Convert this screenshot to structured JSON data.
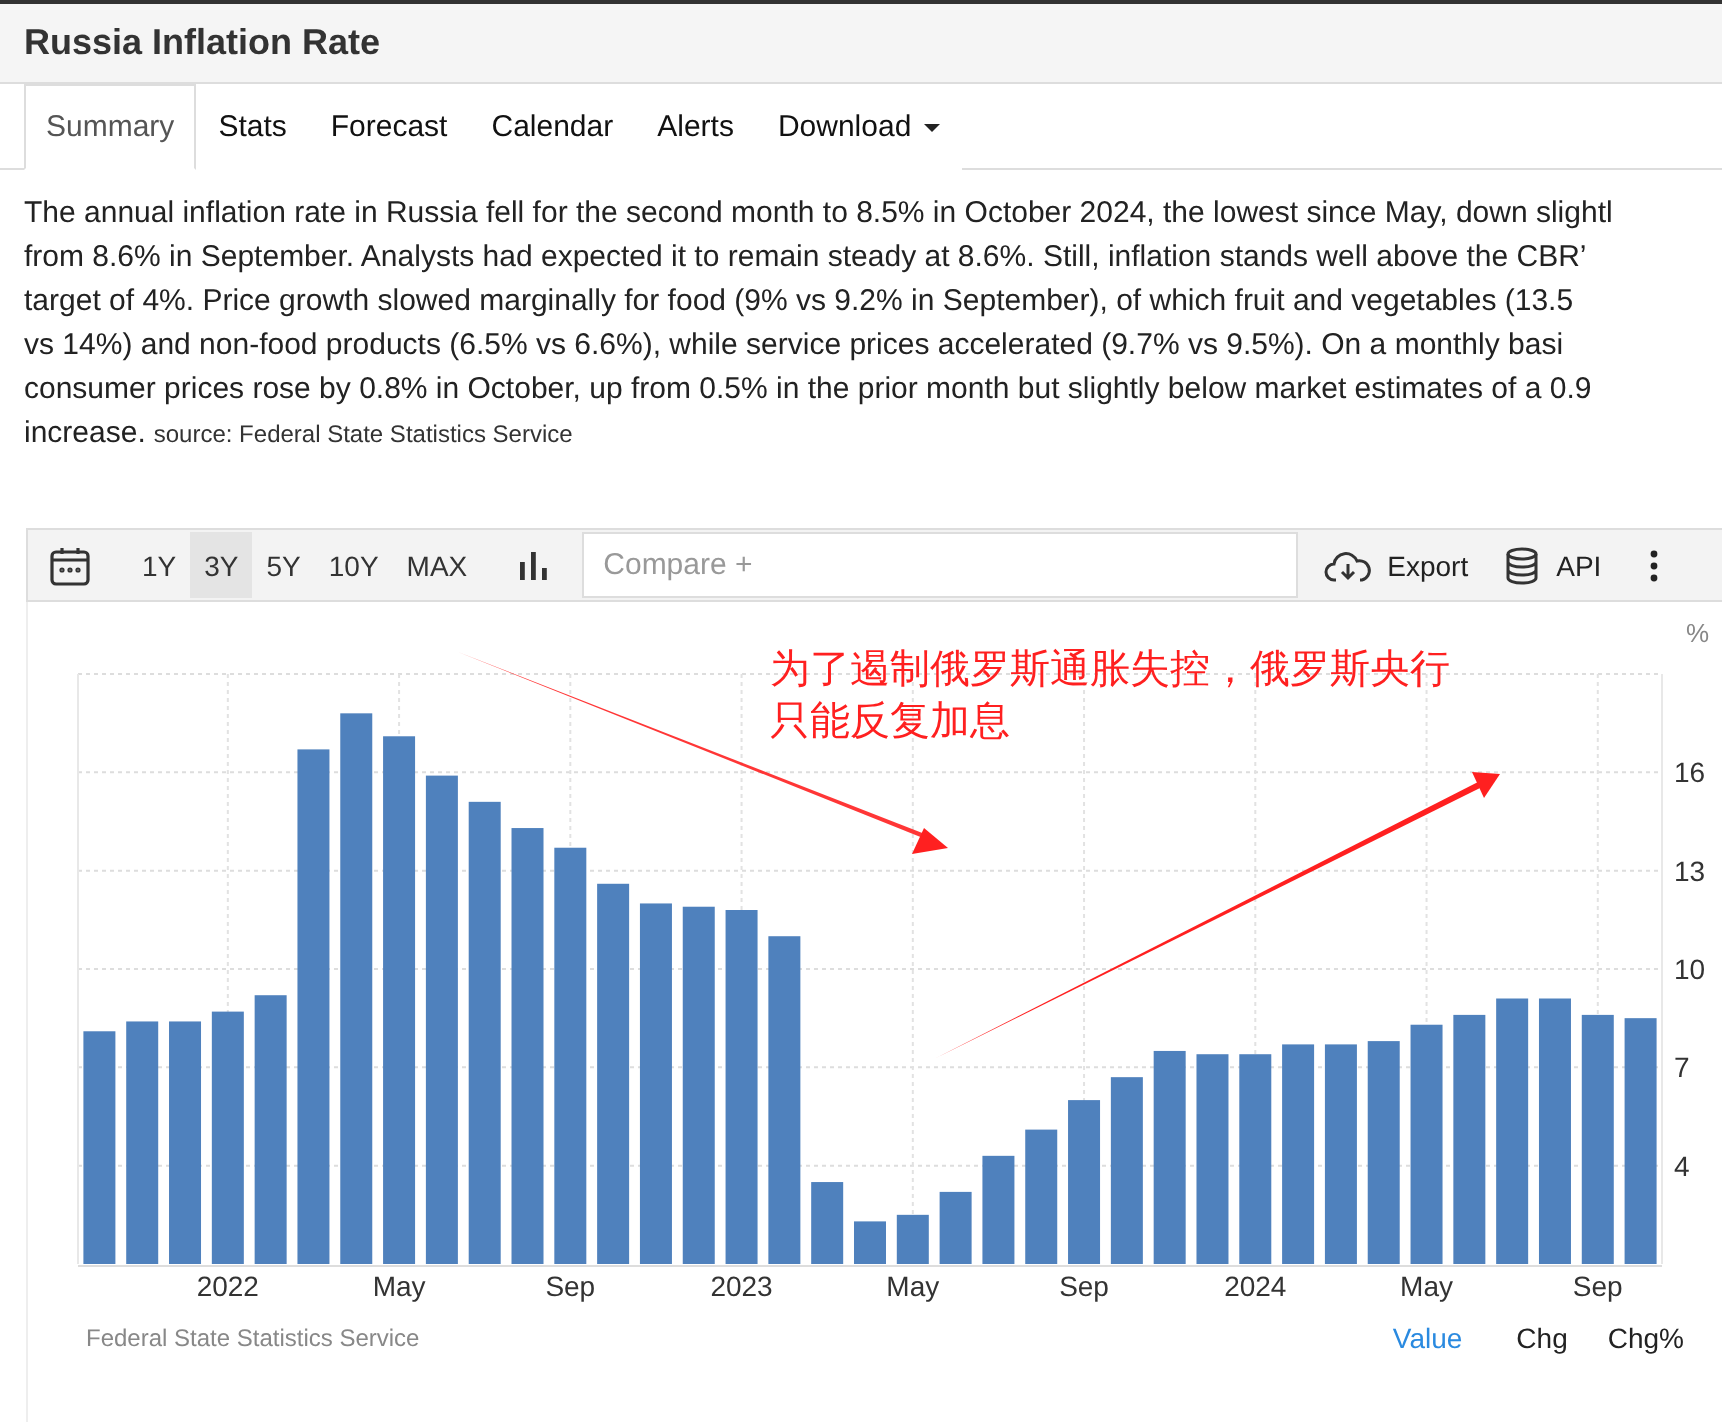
{
  "page_title": "Russia Inflation Rate",
  "tabs": [
    {
      "label": "Summary",
      "selected": true,
      "kind": "tab"
    },
    {
      "label": "Stats",
      "selected": false,
      "kind": "tab"
    },
    {
      "label": "Forecast",
      "selected": false,
      "kind": "tab"
    },
    {
      "label": "Calendar",
      "selected": false,
      "kind": "tab"
    },
    {
      "label": "Alerts",
      "selected": false,
      "kind": "tab"
    },
    {
      "label": "Download",
      "selected": false,
      "kind": "dropdown"
    }
  ],
  "summary": {
    "lines": [
      "The annual inflation rate in Russia fell for the second month to 8.5% in October 2024, the lowest since May, down slightl",
      "from 8.6% in September. Analysts had expected it to remain steady at 8.6%. Still, inflation stands well above the CBR’",
      "target of 4%. Price growth slowed marginally for food (9% vs 9.2% in September), of which fruit and vegetables (13.5",
      "vs 14%) and non-food products (6.5% vs 6.6%), while service prices accelerated (9.7% vs 9.5%). On a monthly basi",
      "consumer prices rose by 0.8% in October, up from 0.5% in the prior month but slightly below market estimates of a 0.9",
      "increase."
    ],
    "source": "source: Federal State Statistics Service"
  },
  "toolbar": {
    "ranges": [
      {
        "label": "1Y",
        "selected": false
      },
      {
        "label": "3Y",
        "selected": true
      },
      {
        "label": "5Y",
        "selected": false
      },
      {
        "label": "10Y",
        "selected": false
      },
      {
        "label": "MAX",
        "selected": false
      }
    ],
    "compare": {
      "placeholder": "Compare +"
    },
    "export": "Export",
    "api": "API"
  },
  "chart": {
    "chart_data": {
      "type": "bar",
      "ylabel": "%",
      "grid": true,
      "categories": [
        null,
        null,
        null,
        "2022",
        null,
        null,
        null,
        "May",
        null,
        null,
        null,
        "Sep",
        null,
        null,
        null,
        "2023",
        null,
        null,
        null,
        "May",
        null,
        null,
        null,
        "Sep",
        null,
        null,
        null,
        "2024",
        null,
        null,
        null,
        "May",
        null,
        null,
        null,
        "Sep",
        null
      ],
      "series": [
        {
          "color": "#4f81bd",
          "values": [
            8.1,
            8.4,
            8.4,
            8.7,
            9.2,
            16.7,
            17.8,
            17.1,
            15.9,
            15.1,
            14.3,
            13.7,
            12.6,
            12.0,
            11.9,
            11.8,
            11.0,
            3.5,
            2.3,
            2.5,
            3.2,
            4.3,
            5.1,
            6.0,
            6.7,
            7.5,
            7.4,
            7.4,
            7.7,
            7.7,
            7.8,
            8.3,
            8.6,
            9.1,
            9.1,
            8.6,
            8.5
          ]
        }
      ],
      "ylim": [
        1,
        19
      ],
      "yticks": [
        4,
        7,
        10,
        13,
        16
      ],
      "annotations": [
        {
          "text": "为了遏制俄罗斯通胀失控，俄罗斯央行只能反复加息"
        }
      ]
    },
    "source": "Federal State Statistics Service",
    "views": [
      {
        "label": "Value",
        "selected": true
      },
      {
        "label": "Chg",
        "selected": false
      },
      {
        "label": "Chg%",
        "selected": false
      }
    ]
  }
}
